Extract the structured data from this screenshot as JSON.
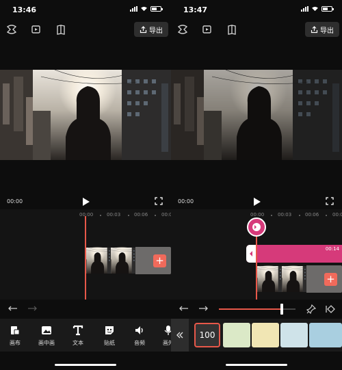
{
  "left": {
    "status_time": "13:46",
    "export_label": "导出",
    "timecode": "00:00",
    "ruler": [
      "00:00",
      "00:03",
      "00:06",
      "00:0"
    ],
    "tools": [
      {
        "label": "画布",
        "icon": "canvas-icon"
      },
      {
        "label": "画中画",
        "icon": "picture-in-picture-icon"
      },
      {
        "label": "文本",
        "icon": "text-icon"
      },
      {
        "label": "贴纸",
        "icon": "sticker-icon"
      },
      {
        "label": "音频",
        "icon": "audio-icon"
      },
      {
        "label": "画外",
        "icon": "voiceover-icon"
      }
    ]
  },
  "right": {
    "status_time": "13:47",
    "export_label": "导出",
    "timecode": "00:00",
    "ruler": [
      "00:00",
      "00:03",
      "00:06",
      "00:0"
    ],
    "pip_duration": "00:14",
    "speed_value": "100",
    "slider_level": 0.82
  },
  "colors": {
    "accent": "#e8584a",
    "pink_track": "#d63a7a",
    "add_button": "#f06a5b",
    "toolbar_bg": "#1a1a1a"
  }
}
